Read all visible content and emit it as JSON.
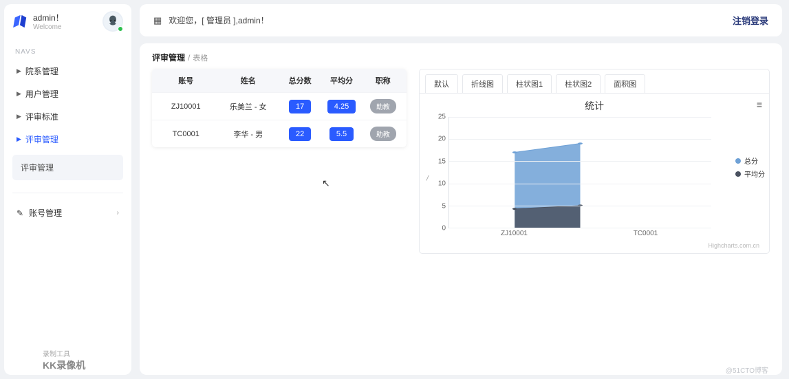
{
  "user": {
    "name": "admin！",
    "role": "Welcome"
  },
  "nav_header": "NAVS",
  "nav": {
    "items": [
      {
        "label": "院系管理"
      },
      {
        "label": "用户管理"
      },
      {
        "label": "评审标准"
      },
      {
        "label": "评审管理",
        "active": true
      }
    ],
    "sub_label": "评审管理",
    "account_label": "账号管理"
  },
  "header": {
    "welcome": "欢迎您，[ 管理员 ],admin！",
    "logout": "注销登录"
  },
  "breadcrumb": {
    "main": "评审管理",
    "sub": "表格"
  },
  "table": {
    "headers": [
      "账号",
      "姓名",
      "总分数",
      "平均分",
      "职称"
    ],
    "rows": [
      {
        "id": "ZJ10001",
        "name": "乐美兰 - 女",
        "total": "17",
        "avg": "4.25",
        "title": "助教"
      },
      {
        "id": "TC0001",
        "name": "李华 - 男",
        "total": "22",
        "avg": "5.5",
        "title": "助教"
      }
    ]
  },
  "tabs": [
    "默认",
    "折线图",
    "柱状图1",
    "柱状图2",
    "面积图"
  ],
  "active_tab": "面积图",
  "chart_data": {
    "type": "area",
    "title": "统计",
    "xlabel": "",
    "ylabel": "/",
    "categories": [
      "ZJ10001",
      "TC0001"
    ],
    "series": [
      {
        "name": "总分",
        "values": [
          17,
          19
        ],
        "color": "#6fa1d6"
      },
      {
        "name": "平均分",
        "values": [
          4.25,
          5
        ],
        "color": "#4a5260"
      }
    ],
    "ylim": [
      0,
      25
    ],
    "yticks": [
      0,
      5,
      10,
      15,
      20,
      25
    ],
    "legend_position": "right",
    "grid": true,
    "credit": "Highcharts.com.cn"
  },
  "watermark": {
    "line1": "录制工具",
    "line2": "KK录像机"
  },
  "footer_mark": "@51CTO博客",
  "colors": {
    "primary": "#2a5bff",
    "badge_gray": "#a0a5ae"
  }
}
